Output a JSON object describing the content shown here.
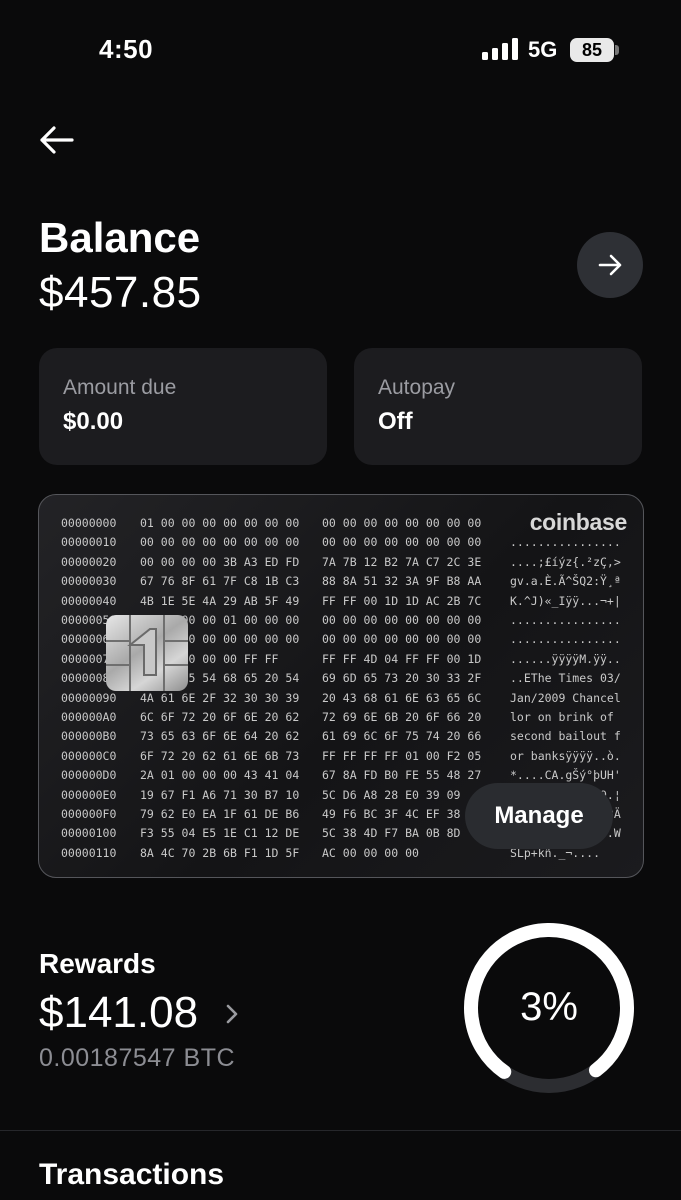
{
  "status_bar": {
    "time": "4:50",
    "network": "5G",
    "battery": "85"
  },
  "balance": {
    "title": "Balance",
    "value": "$457.85"
  },
  "tiles": [
    {
      "label": "Amount due",
      "value": "$0.00"
    },
    {
      "label": "Autopay",
      "value": "Off"
    }
  ],
  "card": {
    "brand": "coinbase",
    "manage_label": "Manage",
    "hex_rows": [
      {
        "addr": "00000000",
        "a": "01 00 00 00 00 00 00 00",
        "b": "00 00 00 00 00 00 00 00",
        "ascii": ""
      },
      {
        "addr": "00000010",
        "a": "00 00 00 00 00 00 00 00",
        "b": "00 00 00 00 00 00 00 00",
        "ascii": "................"
      },
      {
        "addr": "00000020",
        "a": "00 00 00 00 3B A3 ED FD",
        "b": "7A 7B 12 B2 7A C7 2C 3E",
        "ascii": "....;£íýz{.²zÇ,>"
      },
      {
        "addr": "00000030",
        "a": "67 76 8F 61 7F C8 1B C3",
        "b": "88 8A 51 32 3A 9F B8 AA",
        "ascii": "gv.a.È.Ã^ŠQ2:Ÿ¸ª"
      },
      {
        "addr": "00000040",
        "a": "4B 1E 5E 4A 29 AB 5F 49",
        "b": "FF FF 00 1D 1D AC 2B 7C",
        "ascii": "K.^J)«_Iÿÿ...¬+|"
      },
      {
        "addr": "00000050",
        "a": "00 00 00 00 01 00 00 00",
        "b": "00 00 00 00 00 00 00 00",
        "ascii": "................"
      },
      {
        "addr": "00000060",
        "a": "00 00 00 00 00 00 00 00",
        "b": "00 00 00 00 00 00 00 00",
        "ascii": "................"
      },
      {
        "addr": "00000070",
        "a": "00 00 00 00 00 FF FF",
        "b": "FF FF 4D 04 FF FF 00 1D",
        "ascii": "......ÿÿÿÿM.ÿÿ.."
      },
      {
        "addr": "00000080",
        "a": "01 04 45 54 68 65 20 54",
        "b": "69 6D 65 73 20 30 33 2F",
        "ascii": "..EThe Times 03/"
      },
      {
        "addr": "00000090",
        "a": "4A 61 6E 2F 32 30 30 39",
        "b": "20 43 68 61 6E 63 65 6C",
        "ascii": "Jan/2009 Chancel"
      },
      {
        "addr": "000000A0",
        "a": "6C 6F 72 20 6F 6E 20 62",
        "b": "72 69 6E 6B 20 6F 66 20",
        "ascii": "lor on brink of"
      },
      {
        "addr": "000000B0",
        "a": "73 65 63 6F 6E 64 20 62",
        "b": "61 69 6C 6F 75 74 20 66",
        "ascii": "second bailout f"
      },
      {
        "addr": "000000C0",
        "a": "6F 72 20 62 61 6E 6B 73",
        "b": "FF FF FF FF 01 00 F2 05",
        "ascii": "or banksÿÿÿÿ..ò."
      },
      {
        "addr": "000000D0",
        "a": "2A 01 00 00 00 43 41 04",
        "b": "67 8A FD B0 FE 55 48 27",
        "ascii": "*....CA.gŠý°þUH'"
      },
      {
        "addr": "000000E0",
        "a": "19 67 F1 A6 71 30 B7 10",
        "b": "5C D6 A8 28 E0 39 09",
        "ascii": ".gñ¦q0·.\\Ö¨(à9.¦"
      },
      {
        "addr": "000000F0",
        "a": "79 62 E0 EA 1F 61 DE B6",
        "b": "49 F6 BC 3F 4C EF 38",
        "ascii": "ybàê.aÞ¶Iö¼?Lï8Ä"
      },
      {
        "addr": "00000100",
        "a": "F3 55 04 E5 1E C1 12 DE",
        "b": "5C 38 4D F7 BA 0B 8D",
        "ascii": "óU.å.Á.Þ\\8M÷º..W"
      },
      {
        "addr": "00000110",
        "a": "8A 4C 70 2B 6B F1 1D 5F",
        "b": "AC 00 00 00 00",
        "ascii": "ŠLp+kñ._¬...."
      }
    ]
  },
  "rewards": {
    "title": "Rewards",
    "value": "$141.08",
    "btc": "0.00187547 BTC",
    "rate_label": "3%",
    "rate_fraction": 0.8
  },
  "transactions": {
    "title": "Transactions"
  }
}
